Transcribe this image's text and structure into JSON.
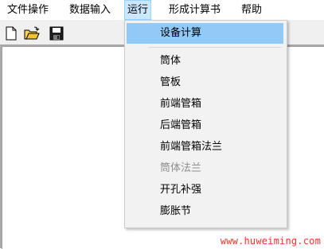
{
  "menubar": {
    "items": [
      {
        "label": "文件操作"
      },
      {
        "label": "数据输入"
      },
      {
        "label": "运行"
      },
      {
        "label": "形成计算书"
      },
      {
        "label": "帮助"
      }
    ]
  },
  "toolbar": {
    "buttons": [
      {
        "icon": "new-document-icon"
      },
      {
        "icon": "open-folder-icon"
      },
      {
        "icon": "save-disk-icon"
      }
    ]
  },
  "run_menu": {
    "items": [
      {
        "label": "设备计算",
        "state": "highlighted"
      },
      {
        "label": "筒体",
        "state": "enabled"
      },
      {
        "label": "管板",
        "state": "enabled"
      },
      {
        "label": "前端管箱",
        "state": "enabled"
      },
      {
        "label": "后端管箱",
        "state": "enabled"
      },
      {
        "label": "前端管箱法兰",
        "state": "enabled"
      },
      {
        "label": "筒体法兰",
        "state": "disabled"
      },
      {
        "label": "开孔补强",
        "state": "enabled"
      },
      {
        "label": "膨胀节",
        "state": "enabled"
      }
    ]
  },
  "watermark": {
    "text": "www.huweiming.com"
  },
  "colors": {
    "menu_active_bg": "#cce8ff",
    "dropdown_highlight": "#91c9f7",
    "disabled_text": "#8d8d8d",
    "watermark_text": "#e8362b",
    "workarea_bg": "#ababab"
  }
}
